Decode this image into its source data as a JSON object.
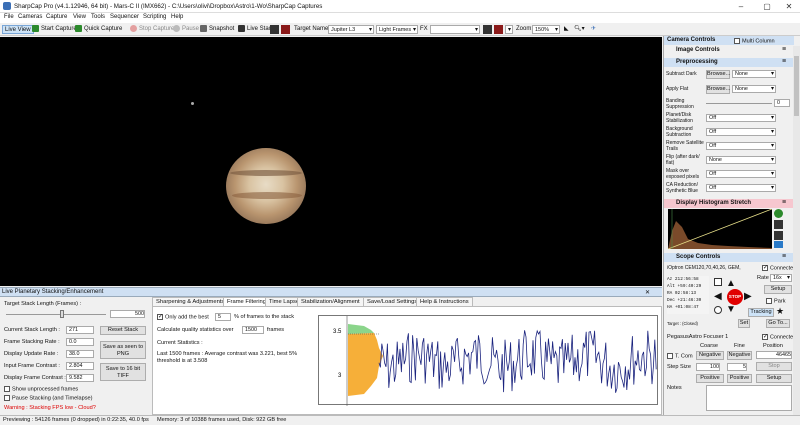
{
  "window": {
    "title": "SharpCap Pro (v4.1.12946, 64 bit) - Mars-C II (IMX662) - C:\\Users\\olivi\\Dropbox\\Astro\\1-Wo\\SharpCap Captures",
    "controls": [
      "–",
      "▢",
      "✕"
    ]
  },
  "menu": [
    "File",
    "Cameras",
    "Capture",
    "View",
    "Tools",
    "Sequencer",
    "Scripting",
    "Help"
  ],
  "toolbar": {
    "live_view": "Live View",
    "start_capture": "Start Capture",
    "quick_capture": "Quick Capture",
    "stop_capture": "Stop Capture",
    "pause": "Pause",
    "snapshot": "Snapshot",
    "live_stack": "Live Stack",
    "target_name_label": "Target Name :",
    "target_name": "Jupiter L3",
    "frame_type": "Light Frames",
    "fx_label": "FX",
    "zoom_label": "Zoom:",
    "zoom": "150%"
  },
  "planetary_panel": {
    "title": "Live Planetary Stacking/Enhancement",
    "target_stack_length_label": "Target Stack Length (Frames) :",
    "target_stack_length": "500",
    "current_stack_length_label": "Current Stack Length :",
    "current_stack_length": "271",
    "frame_stacking_rate_label": "Frame Stacking Rate :",
    "frame_stacking_rate": "0.0",
    "display_update_rate_label": "Display Update Rate :",
    "display_update_rate": "38.0",
    "input_frame_contrast_label": "Input Frame Contrast :",
    "input_frame_contrast": "2.804",
    "display_frame_contrast_label": "Display Frame Contrast :",
    "display_frame_contrast": "9.582",
    "reset_stack": "Reset Stack",
    "save_png": "Save as seen to PNG",
    "save_tiff": "Save to 16 bit TIFF",
    "show_unprocessed": "Show unprocessed frames",
    "pause_stacking": "Pause Stacking (and Timelapse)",
    "warning": "Warning : Stacking FPS low - Cloud?"
  },
  "tabs": [
    "Sharpening & Adjustments",
    "Frame Filtering",
    "Time Lapse",
    "Stabilization/Alignment",
    "Save/Load Settings",
    "Help & Instructions"
  ],
  "frame_filtering": {
    "only_add_label": "Only add the best",
    "only_add_value": "5",
    "only_add_suffix": "% of frames to the stack",
    "calc_label": "Calculate quality statistics over",
    "calc_value": "1500",
    "calc_suffix": "frames",
    "current_stats_label": "Current Statistics :",
    "current_stats": "Last 1500 frames : Average contrast was 3.221, best 5% threshold is at 3.508",
    "y_ticks": [
      "3.5",
      "3"
    ]
  },
  "status": {
    "preview": "Previewing : 54126 frames (0 dropped) in 0:22:35, 40.0 fps",
    "memory": "Memory: 3 of 10388 frames used, Disk: 922 GB free"
  },
  "camera_controls": {
    "title": "Camera Controls",
    "multi_column": "Multi Column",
    "image_controls": "Image Controls",
    "preprocessing": "Preprocessing",
    "browse": "Browse...",
    "rows": [
      {
        "label": "Subtract Dark",
        "value": "None"
      },
      {
        "label": "Apply Flat",
        "value": "None"
      },
      {
        "label": "Banding Suppression",
        "value": "0"
      },
      {
        "label": "Planet/Disk Stabilization",
        "value": "Off"
      },
      {
        "label": "Background Subtraction",
        "value": "Off"
      },
      {
        "label": "Remove Satellite Trails",
        "value": "Off"
      },
      {
        "label": "Flip (after dark/ flat)",
        "value": "None"
      },
      {
        "label": "Mask over exposed pixels",
        "value": "Off"
      },
      {
        "label": "CA Reduction/ Synthetic Blue",
        "value": "Off"
      }
    ],
    "histogram": "Display Histogram Stretch",
    "scope_controls": "Scope Controls",
    "mount": "iOptron CEM120,70,40,26, GEM,",
    "connected": "Connected",
    "rate_label": "Rate",
    "rate": "16x",
    "setup": "Setup",
    "park": "Park",
    "tracking": "Tracking",
    "set": "Set",
    "goto": "Go To...",
    "target_label": "Target : (Closed)",
    "coords": [
      {
        "k": "Az",
        "v": "212:56:58"
      },
      {
        "k": "Alt",
        "v": "+59:40:29"
      },
      {
        "k": "RA",
        "v": "02:58:13"
      },
      {
        "k": "Dec",
        "v": "+21:46:30"
      },
      {
        "k": "HA",
        "v": "+01:08:47"
      }
    ],
    "focuser": "PegasusAstro Focuser 1",
    "coarse": "Coarse",
    "fine": "Fine",
    "position_label": "Position",
    "position": "46465",
    "temp_comp": "T. Com",
    "negative": "Negative",
    "positive": "Positive",
    "step_size_label": "Step Size",
    "step_coarse": "100",
    "step_fine": "5",
    "stop": "Stop",
    "stop_mount": "STOP",
    "notes": "Notes"
  },
  "colors": {
    "stop_red": "#e00000",
    "panel_blue": "#cfe0f3",
    "histogram_pink": "#f6c7cf",
    "graph_line": "#1a237e",
    "graph_orange": "#f5a623",
    "graph_green": "#7ed07e"
  }
}
